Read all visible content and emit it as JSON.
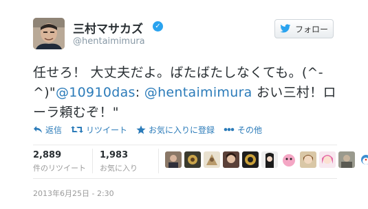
{
  "user": {
    "display_name": "三村マサカズ",
    "handle": "@hentaimimura",
    "verified_icon": "verified-badge-icon",
    "avatar_icon": "profile-avatar"
  },
  "follow_button": {
    "label": "フォロー",
    "icon": "twitter-bird-icon"
  },
  "tweet": {
    "text_part1": "任せろ！ 大丈夫だよ。ばたばたしなくても。(^-^)\"",
    "mention1": "@10910das",
    "colon": ": ",
    "mention2": "@hentaimimura",
    "text_part2": " おい三村！ローラ頼むぞ！\""
  },
  "actions": [
    {
      "label": "返信",
      "icon": "reply-icon"
    },
    {
      "label": "リツイート",
      "icon": "retweet-icon"
    },
    {
      "label": "お気に入りに登録",
      "icon": "star-icon"
    },
    {
      "label": "その他",
      "icon": "more-icon"
    }
  ],
  "stats": {
    "retweets": {
      "value": "2,889",
      "label": "件のリツイート"
    },
    "favorites": {
      "value": "1,983",
      "label": "お気に入り"
    }
  },
  "timestamp": "2013年6月25日 - 2:30",
  "colors": {
    "link": "#2b7bb9",
    "verified": "#2aa3ef",
    "text": "#292f33",
    "muted": "#999999"
  }
}
